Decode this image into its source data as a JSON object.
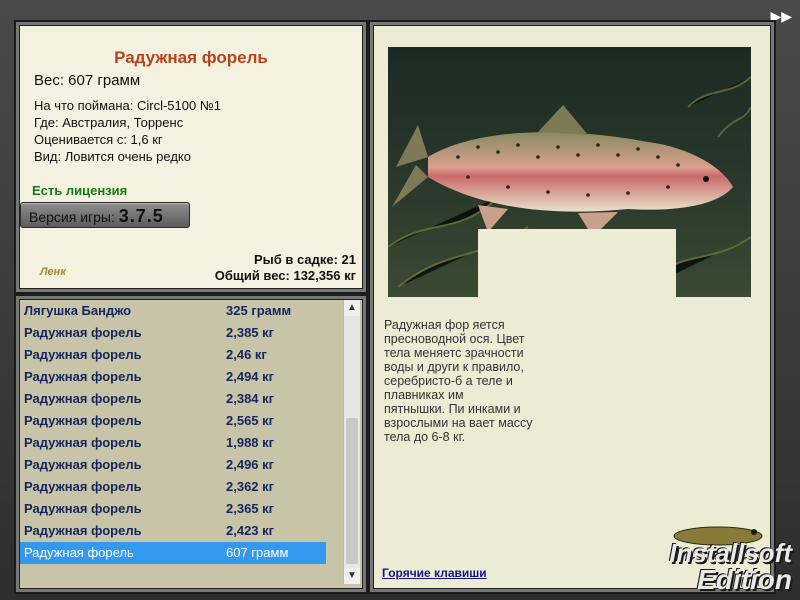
{
  "fish": {
    "title": "Радужная форель",
    "weight": "Вес: 607 грамм",
    "lure": "На что поймана: Circl-5100 №1",
    "location": "Где: Австралия, Торренс",
    "value": "Оценивается с: 1,6 кг",
    "rarity": "Вид: Ловится очень редко"
  },
  "license": "Есть лицензия",
  "version": {
    "label": "Версия игры:",
    "number": "3.7.5"
  },
  "menu_logo": "Ленк",
  "stats": {
    "cage": "Рыб в садке: 21",
    "total": "Общий вес: 132,356 кг"
  },
  "catch_list": [
    {
      "name": "Лягушка Банджо",
      "weight": "325 грамм"
    },
    {
      "name": "Радужная форель",
      "weight": "2,385 кг"
    },
    {
      "name": "Радужная форель",
      "weight": "2,46 кг"
    },
    {
      "name": "Радужная форель",
      "weight": "2,494 кг"
    },
    {
      "name": "Радужная форель",
      "weight": "2,384 кг"
    },
    {
      "name": "Радужная форель",
      "weight": "2,565 кг"
    },
    {
      "name": "Радужная форель",
      "weight": "1,988 кг"
    },
    {
      "name": "Радужная форель",
      "weight": "2,496 кг"
    },
    {
      "name": "Радужная форель",
      "weight": "2,362 кг"
    },
    {
      "name": "Радужная форель",
      "weight": "2,365 кг"
    },
    {
      "name": "Радужная форель",
      "weight": "2,423 кг"
    },
    {
      "name": "Радужная форель",
      "weight": "607 грамм"
    }
  ],
  "selected_index": 11,
  "description_lines": [
    "Радужная фор                                            яется",
    "пресноводной                                            ося. Цвет",
    "тела меняетс                                            зрачности",
    "воды и други                                            к правило,",
    "серебристо-б                                            а теле и",
    "плавниках им",
    "пятнышки. Пи                                            инками и",
    "взрослыми на                                            вает массу",
    "тела до 6-8 кг."
  ],
  "hotkeys": "Горячие клавиши",
  "watermark": {
    "line1": "Installsoft",
    "line2": "Edition"
  },
  "colors": {
    "title": "#b8431a",
    "license": "#157a15",
    "list_text": "#16265c",
    "selected": "#3399ee"
  }
}
